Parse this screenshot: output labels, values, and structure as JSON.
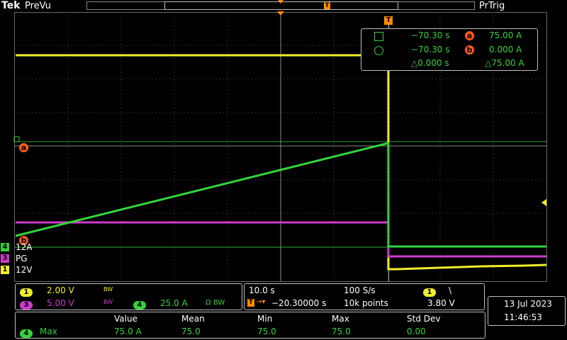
{
  "header": {
    "logo": "Tek",
    "acq_state": "PreVu",
    "trig_state": "PrTrig",
    "trigger_marker": "T"
  },
  "cursor_readout": {
    "a_time": "−70.30 s",
    "a_value": "75.00 A",
    "b_time": "−70.30 s",
    "b_value": "0.000 A",
    "delta_time": "△0.000 s",
    "delta_value": "△75.00 A",
    "a_label": "a",
    "b_label": "b"
  },
  "screen_cursors": {
    "a_label": "a",
    "b_label": "b"
  },
  "channels": [
    {
      "num": "4",
      "label": "12A",
      "color": "#35d23b"
    },
    {
      "num": "3",
      "label": "PG",
      "color": "#cc3ccc"
    },
    {
      "num": "1",
      "label": "12V",
      "color": "#f2ee2a"
    }
  ],
  "vertical_panel": {
    "ch1_num": "1",
    "ch1_scale": "2.00 V",
    "ch1_bw": "BW",
    "ch3_num": "3",
    "ch3_scale": "5.00 V",
    "ch3_bw": "BW",
    "ch4_num": "4",
    "ch4_scale": "25.0 A",
    "ch4_bw": "Ω BW"
  },
  "horizontal_panel": {
    "timebase": "10.0 s",
    "sample_rate": "100 S/s",
    "trig_pos_marker": "T",
    "trig_offset": "−20.30000 s",
    "record_len": "10k points",
    "trig_src": "1",
    "trig_slope": "\\",
    "trig_level": "3.80 V"
  },
  "datetime": {
    "date": "13 Jul  2023",
    "time": "11:46:53"
  },
  "measurements": {
    "headers": [
      "Value",
      "Mean",
      "Min",
      "Max",
      "Std Dev"
    ],
    "rows": [
      {
        "ch": "4",
        "name": "Max",
        "cells": [
          "75.0 A",
          "75.0",
          "75.0",
          "75.0",
          "0.00"
        ]
      }
    ]
  }
}
